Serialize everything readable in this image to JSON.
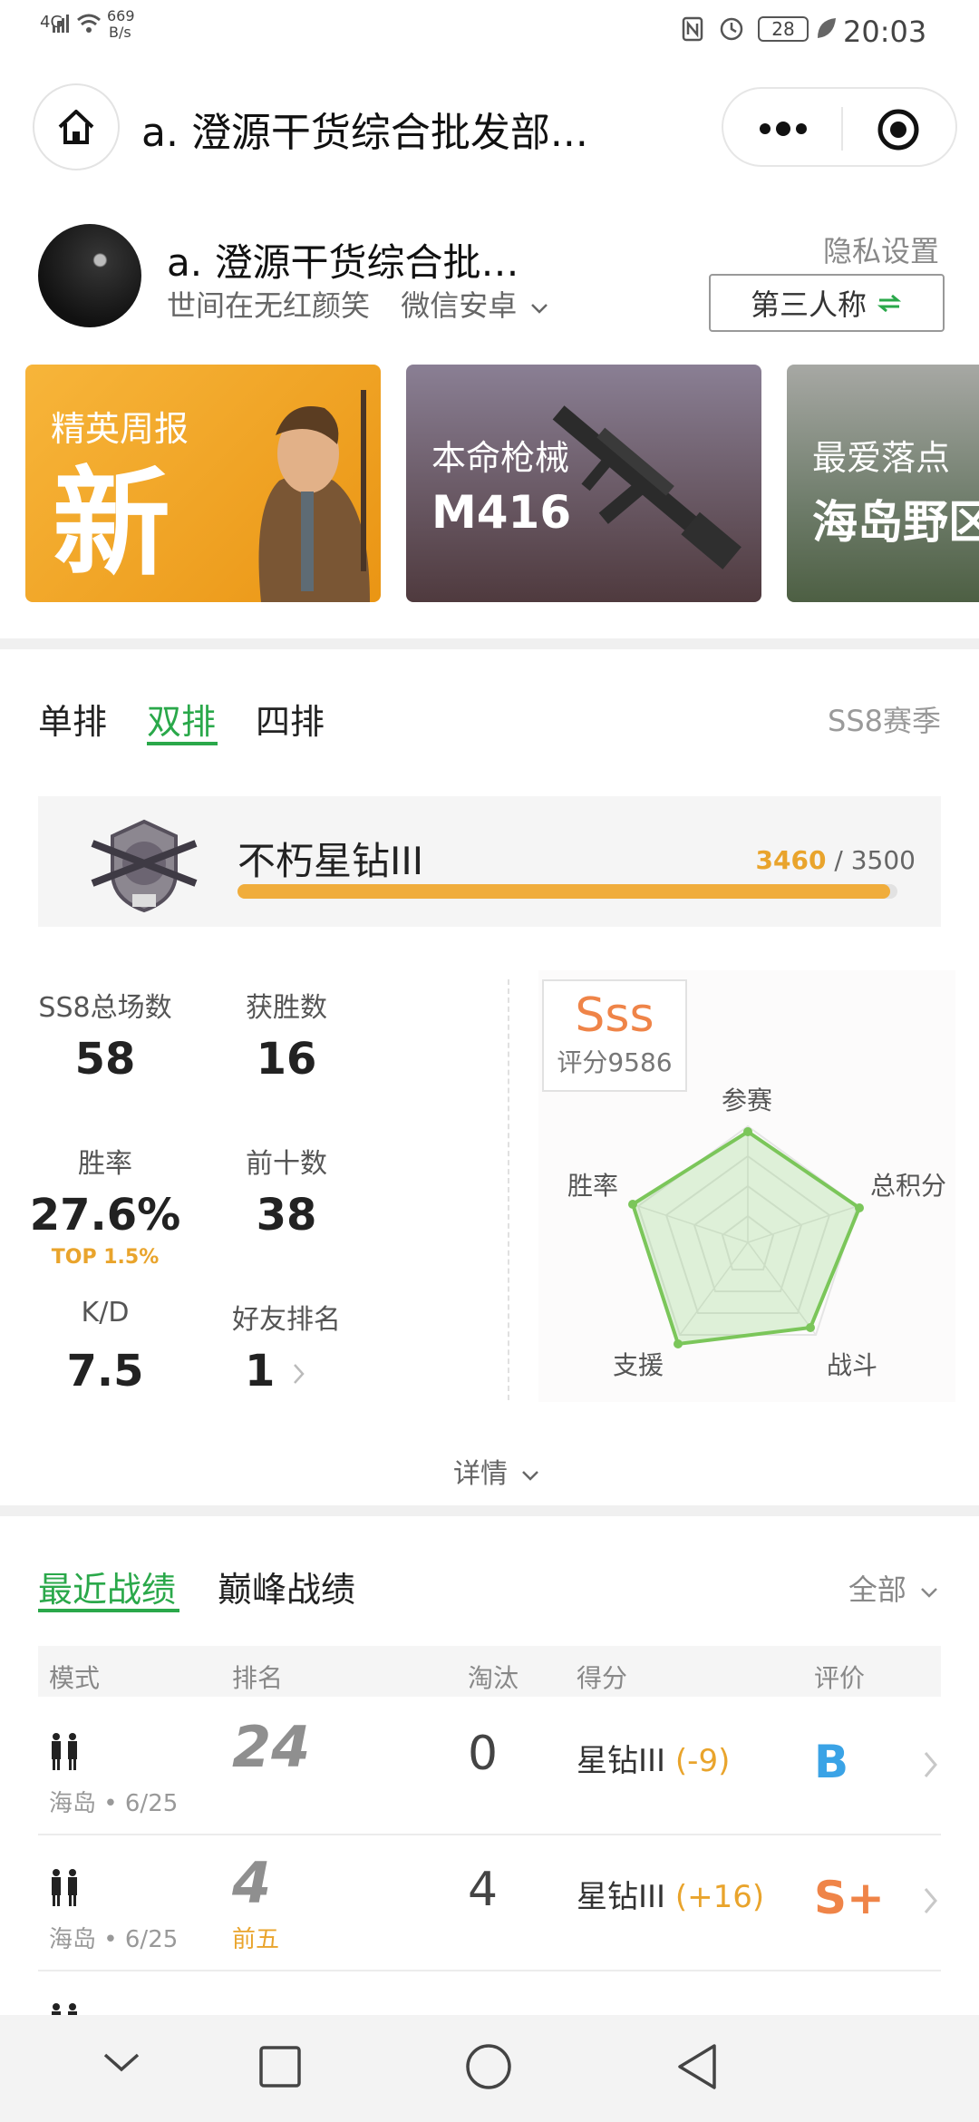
{
  "status_bar": {
    "network": "4G",
    "speed": "669",
    "speed_unit": "B/s",
    "battery": "28",
    "time": "20:03"
  },
  "nav": {
    "title": "a. 澄源干货综合批发部..."
  },
  "profile": {
    "name": "a. 澄源干货综合批…",
    "signature": "世间在无红颜笑",
    "platform": "微信安卓",
    "privacy": "隐私设置",
    "pov": "第三人称"
  },
  "cards": [
    {
      "label": "精英周报",
      "value": "新",
      "bg": "#f2a226"
    },
    {
      "label": "本命枪械",
      "value": "M416",
      "bg": "#6a5a68"
    },
    {
      "label": "最爱落点",
      "value": "海岛野区",
      "bg": "#7e8a7a"
    }
  ],
  "mode_tabs": [
    "单排",
    "双排",
    "四排"
  ],
  "active_mode_tab": "双排",
  "season": "SS8赛季",
  "rank": {
    "title": "不朽星钻III",
    "current": "3460",
    "separator": "/",
    "max": "3500",
    "progress": 0.9886
  },
  "stats": [
    {
      "label": "SS8总场数",
      "value": "58"
    },
    {
      "label": "获胜数",
      "value": "16"
    },
    {
      "label": "胜率",
      "value": "27.6%",
      "sub": "TOP 1.5%"
    },
    {
      "label": "前十数",
      "value": "38"
    },
    {
      "label": "K/D",
      "value": "7.5"
    },
    {
      "label": "好友排名",
      "value": "1"
    }
  ],
  "rating": {
    "grade": "Sss",
    "score_text": "评分9586",
    "axes": [
      "参赛",
      "总积分",
      "战斗",
      "支援",
      "胜率"
    ]
  },
  "detail_label": "详情",
  "record_tabs": [
    "最近战绩",
    "巅峰战绩"
  ],
  "active_record_tab": "最近战绩",
  "record_filter": "全部",
  "table_headers": [
    "模式",
    "排名",
    "淘汰",
    "得分",
    "评价"
  ],
  "records": [
    {
      "map": "海岛",
      "date": "6/25",
      "rank": "24",
      "rank_tag": "",
      "kills": "0",
      "score_rank": "星钻III",
      "delta": "(-9)",
      "grade": "B",
      "grade_color": "#3aa3e6"
    },
    {
      "map": "海岛",
      "date": "6/25",
      "rank": "4",
      "rank_tag": "前五",
      "kills": "4",
      "score_rank": "星钻III",
      "delta": "(+16)",
      "grade": "S+",
      "grade_color": "#ef8448"
    }
  ],
  "colors": {
    "accent_green": "#2aa84a",
    "accent_orange": "#e9a42c"
  }
}
